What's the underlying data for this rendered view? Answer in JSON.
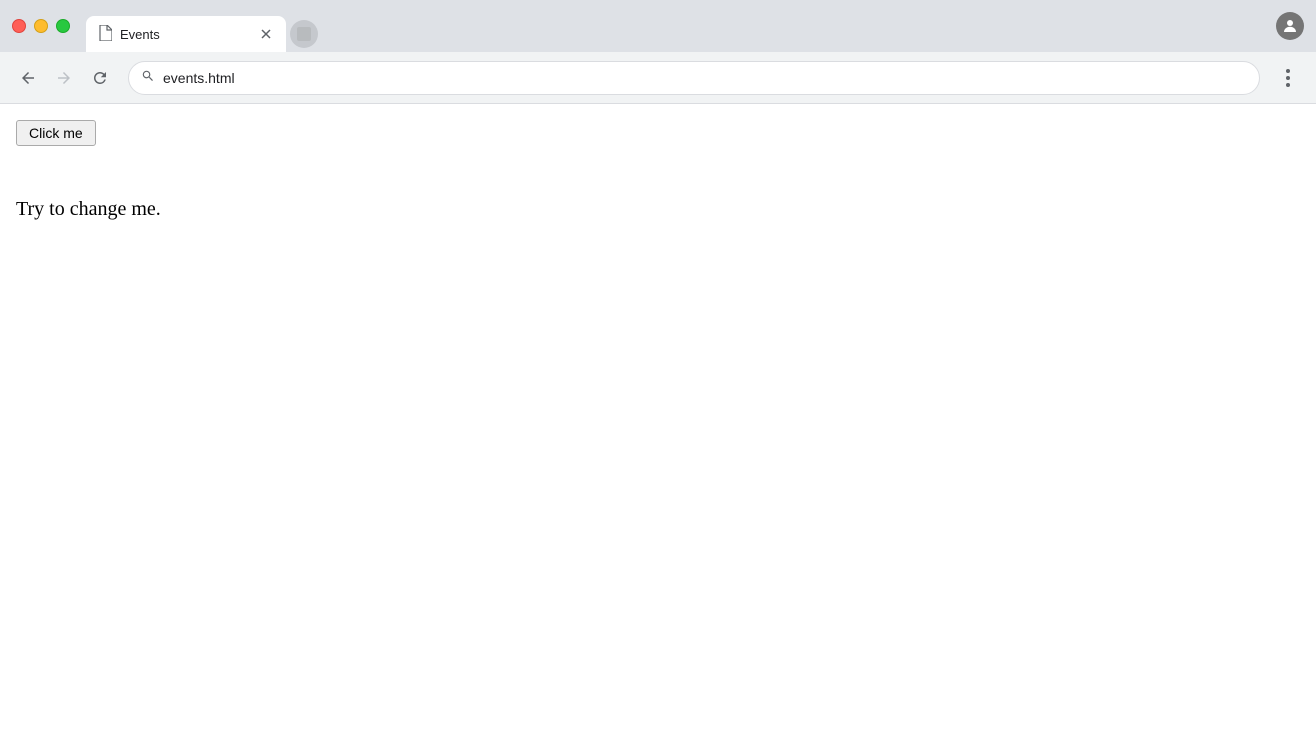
{
  "browser": {
    "traffic_lights": {
      "close_color": "#ff5f57",
      "minimize_color": "#febc2e",
      "maximize_color": "#28c840"
    },
    "tab": {
      "title": "Events",
      "icon": "📄"
    },
    "address_bar": {
      "url": "events.html",
      "search_icon": "🔍"
    },
    "nav": {
      "back_icon": "←",
      "forward_icon": "→",
      "reload_icon": "↻",
      "more_icon": "⋮"
    }
  },
  "page": {
    "button_label": "Click me",
    "paragraph_text": "Try to change me."
  }
}
